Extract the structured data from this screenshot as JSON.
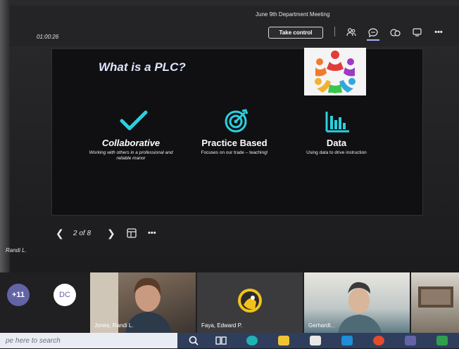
{
  "meeting": {
    "title": "June 9th Department Meeting",
    "timer": "01:00:26",
    "take_control_label": "Take control"
  },
  "toolbar_icons": [
    "people-icon",
    "chat-icon",
    "reactions-icon",
    "share-icon",
    "more-icon"
  ],
  "slide": {
    "title": "What is a PLC?",
    "columns": [
      {
        "icon": "checkmark-icon",
        "heading": "Collaborative",
        "subtext": "Working with others in a professional and reliable manor"
      },
      {
        "icon": "target-icon",
        "heading": "Practice Based",
        "subtext": "Focuses on our trade – teaching!"
      },
      {
        "icon": "bar-chart-icon",
        "heading": "Data",
        "subtext": "Using data to drive instruction"
      }
    ]
  },
  "slide_nav": {
    "page_indicator": "2 of 8"
  },
  "presenter_label": "Randi L.",
  "participants": {
    "overflow_count": "+11",
    "initials_badge": "DC",
    "tiles": [
      {
        "name": "Jones, Randi L."
      },
      {
        "name": "Faya, Edward P."
      },
      {
        "name": "Gerhardt..."
      }
    ]
  },
  "taskbar": {
    "search_placeholder": "pe here to search"
  },
  "colors": {
    "accent_cyan": "#2ad1e0",
    "teams_purple": "#6264a7",
    "slide_bg": "#101012"
  }
}
